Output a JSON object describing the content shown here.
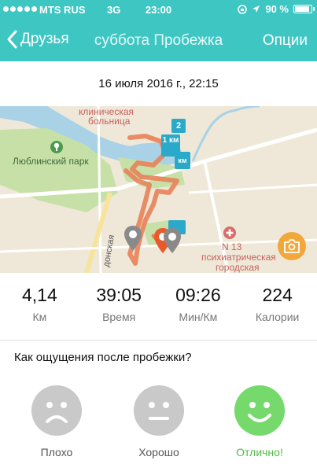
{
  "status_bar": {
    "carrier": "MTS RUS",
    "network": "3G",
    "time": "23:00",
    "battery": "90 %",
    "battery_level": 0.9
  },
  "nav": {
    "back_label": "Друзья",
    "title": "суббота Пробежка",
    "options_label": "Опции"
  },
  "date_time": "16 июля 2016 г., 22:15",
  "map": {
    "labels": {
      "park": "Люблинский парк",
      "hospital_top1": "клиническая",
      "hospital_top2": "больница",
      "hospital_n13": "N 13",
      "psych1": "психиатрическая",
      "psych2": "городская",
      "street": "донская"
    },
    "markers": [
      "1 км",
      "2",
      "км"
    ],
    "route_color": "#e8825a",
    "water_color": "#a9d2e6",
    "park_color": "#c7e0a8"
  },
  "stats": [
    {
      "value": "4,14",
      "label": "Км"
    },
    {
      "value": "39:05",
      "label": "Время"
    },
    {
      "value": "09:26",
      "label": "Мин/Км"
    },
    {
      "value": "224",
      "label": "Калории"
    }
  ],
  "question": "Как ощущения после пробежки?",
  "moods": {
    "bad": "Плохо",
    "good": "Хорошо",
    "great": "Отлично!"
  },
  "colors": {
    "accent": "#3ec6c3",
    "great": "#76d96c",
    "camera": "#f2a73a"
  }
}
